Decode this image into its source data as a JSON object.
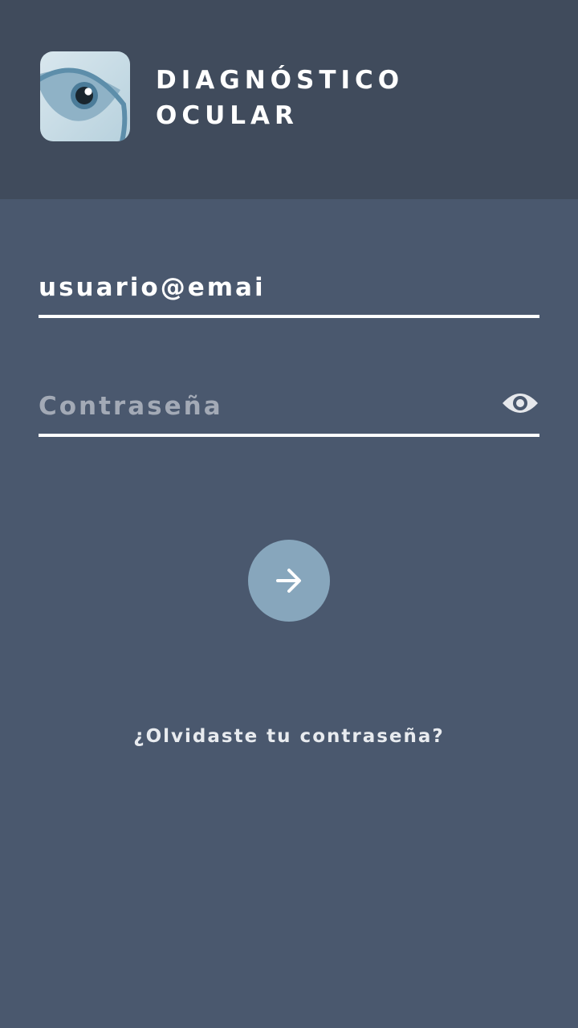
{
  "app": {
    "brand_line1": "DIAGNÓSTICO",
    "brand_line2": "OCULAR",
    "logo_icon": "eye-icon"
  },
  "login": {
    "email_value": "usuario@emai",
    "password_placeholder": "Contraseña",
    "password_value": "",
    "show_password_icon": "eye-icon",
    "submit_icon": "arrow-right-icon",
    "forgot_label": "¿Olvidaste tu contraseña?"
  },
  "colors": {
    "header_bg": "#404b5c",
    "body_bg": "#4a586e",
    "accent": "#87a6bc",
    "text": "#ffffff",
    "placeholder": "#a3aab6"
  }
}
